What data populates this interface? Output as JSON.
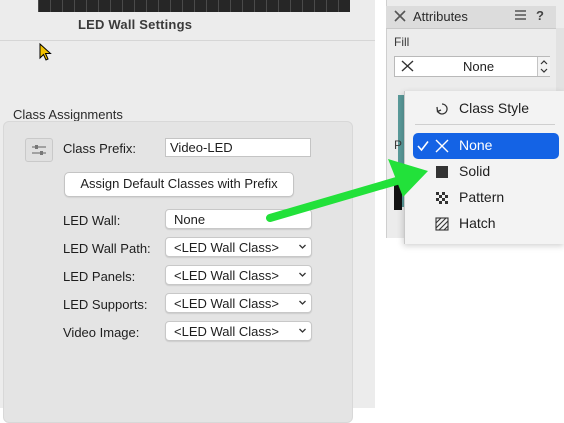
{
  "dialog": {
    "title": "LED Wall Settings",
    "section_title": "Class Assignments",
    "prefix_label": "Class Prefix:",
    "prefix_value": "Video-LED",
    "assign_button": "Assign Default Classes with Prefix",
    "rows": [
      {
        "label": "LED Wall:",
        "value": "None"
      },
      {
        "label": "LED Wall Path:",
        "value": "<LED Wall Class>"
      },
      {
        "label": "LED Panels:",
        "value": "<LED Wall Class>"
      },
      {
        "label": "LED Supports:",
        "value": "<LED Wall Class>"
      },
      {
        "label": "Video Image:",
        "value": "<LED Wall Class>"
      }
    ]
  },
  "palette": {
    "title": "Attributes",
    "help": "?",
    "fill_label": "Fill",
    "fill_value": "None",
    "partial_label": "P"
  },
  "fill_menu": {
    "items": [
      {
        "label": "Class Style",
        "icon": "class-style-icon"
      },
      {
        "label": "None",
        "icon": "x-icon",
        "selected": true
      },
      {
        "label": "Solid",
        "icon": "solid-square-icon"
      },
      {
        "label": "Pattern",
        "icon": "checker-pattern-icon"
      },
      {
        "label": "Hatch",
        "icon": "hatch-icon"
      }
    ]
  },
  "colors": {
    "selection": "#1463e5",
    "arrow": "#22e13a",
    "dialog_bg": "#ececec"
  }
}
